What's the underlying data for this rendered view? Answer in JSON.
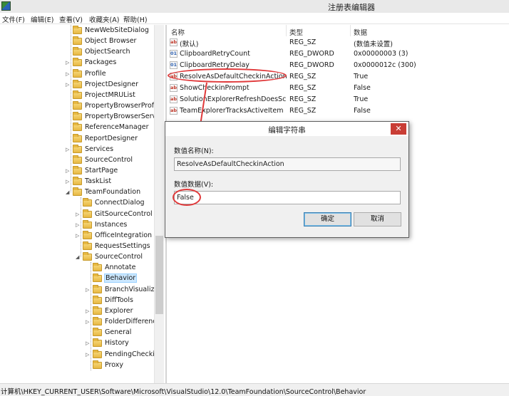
{
  "window": {
    "title": "注册表编辑器"
  },
  "menu": [
    "文件(F)",
    "编辑(E)",
    "查看(V)",
    "收藏夹(A)",
    "帮助(H)"
  ],
  "tree": [
    {
      "label": "NewWebSiteDialog",
      "expander": false
    },
    {
      "label": "Object Browser",
      "expander": false
    },
    {
      "label": "ObjectSearch",
      "expander": false
    },
    {
      "label": "Packages",
      "expander": true
    },
    {
      "label": "Profile",
      "expander": true
    },
    {
      "label": "ProjectDesigner",
      "expander": true
    },
    {
      "label": "ProjectMRUList",
      "expander": false
    },
    {
      "label": "PropertyBrowserProfil",
      "expander": false
    },
    {
      "label": "PropertyBrowserServic",
      "expander": false
    },
    {
      "label": "ReferenceManager",
      "expander": false
    },
    {
      "label": "ReportDesigner",
      "expander": false
    },
    {
      "label": "Services",
      "expander": true
    },
    {
      "label": "SourceControl",
      "expander": false
    },
    {
      "label": "StartPage",
      "expander": true
    },
    {
      "label": "TaskList",
      "expander": true
    },
    {
      "label": "TeamFoundation",
      "expander": "open"
    },
    {
      "label": "ConnectDialog",
      "expander": false
    },
    {
      "label": "GitSourceControl",
      "expander": true
    },
    {
      "label": "Instances",
      "expander": true
    },
    {
      "label": "OfficeIntegration",
      "expander": true
    },
    {
      "label": "RequestSettings",
      "expander": false
    },
    {
      "label": "SourceControl",
      "expander": "open"
    },
    {
      "label": "Annotate",
      "expander": false
    },
    {
      "label": "Behavior",
      "expander": false,
      "selected": true
    },
    {
      "label": "BranchVisualiza",
      "expander": true
    },
    {
      "label": "DiffTools",
      "expander": false
    },
    {
      "label": "Explorer",
      "expander": true
    },
    {
      "label": "FolderDifferenc",
      "expander": true
    },
    {
      "label": "General",
      "expander": false
    },
    {
      "label": "History",
      "expander": true
    },
    {
      "label": "PendingCheckin",
      "expander": true
    },
    {
      "label": "Proxy",
      "expander": false
    }
  ],
  "list": {
    "headers": {
      "name": "名称",
      "type": "类型",
      "data": "数据"
    },
    "rows": [
      {
        "icon": "ab",
        "name": "(默认)",
        "type": "REG_SZ",
        "data": "(数值未设置)"
      },
      {
        "icon": "dword",
        "name": "ClipboardRetryCount",
        "type": "REG_DWORD",
        "data": "0x00000003 (3)"
      },
      {
        "icon": "dword",
        "name": "ClipboardRetryDelay",
        "type": "REG_DWORD",
        "data": "0x0000012c (300)"
      },
      {
        "icon": "ab",
        "name": "ResolveAsDefaultCheckinAction",
        "type": "REG_SZ",
        "data": "True"
      },
      {
        "icon": "ab",
        "name": "ShowCheckinPrompt",
        "type": "REG_SZ",
        "data": "False"
      },
      {
        "icon": "ab",
        "name": "SolutionExplorerRefreshDoesSc...",
        "type": "REG_SZ",
        "data": "True"
      },
      {
        "icon": "ab",
        "name": "TeamExplorerTracksActiveItem",
        "type": "REG_SZ",
        "data": "False"
      }
    ]
  },
  "dialog": {
    "title": "编辑字符串",
    "close": "✕",
    "name_label": "数值名称(N):",
    "name_value": "ResolveAsDefaultCheckinAction",
    "data_label": "数值数据(V):",
    "data_value": "False",
    "ok_label": "确定",
    "cancel_label": "取消"
  },
  "status": {
    "path": "计算机\\HKEY_CURRENT_USER\\Software\\Microsoft\\VisualStudio\\12.0\\TeamFoundation\\SourceControl\\Behavior"
  },
  "colors": {
    "highlight": "#e0393a",
    "selection": "#cce8ff",
    "close_button": "#c93d35"
  }
}
